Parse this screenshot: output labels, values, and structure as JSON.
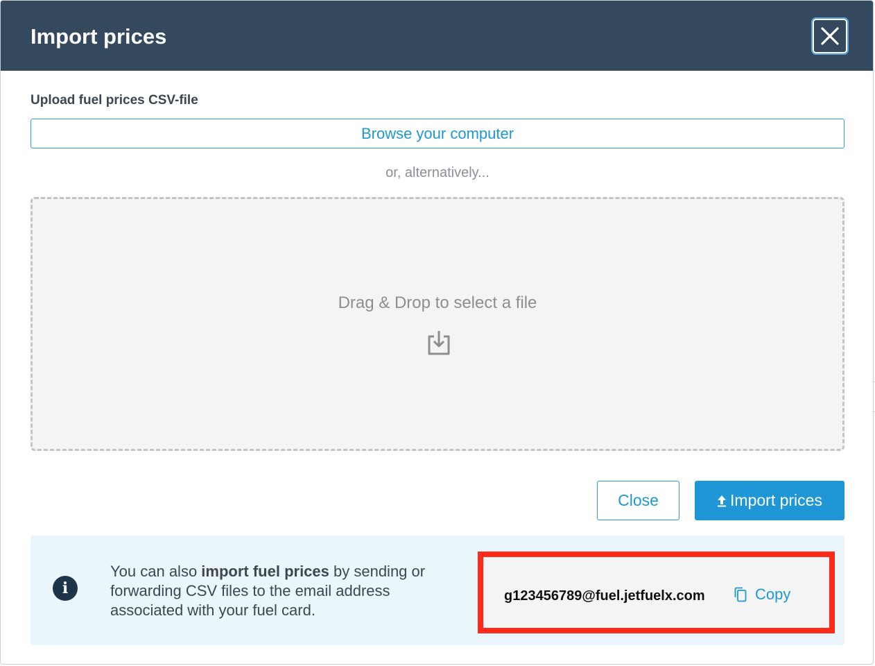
{
  "header": {
    "title": "Import prices",
    "close_icon": "close-icon"
  },
  "upload": {
    "label": "Upload fuel prices CSV-file",
    "browse_label": "Browse your computer",
    "alternative_text": "or, alternatively...",
    "dropzone_text": "Drag & Drop to select a file",
    "dropzone_icon": "download-tray-icon"
  },
  "footer": {
    "close_label": "Close",
    "import_label": "Import prices",
    "import_icon": "upload-arrow-icon"
  },
  "info": {
    "icon": "info-icon",
    "icon_glyph": "i",
    "text_before": "You can also ",
    "text_bold": "import fuel prices",
    "text_after": " by sending or forwarding CSV files to the email address associated with your fuel card.",
    "email": "g123456789@fuel.jetfuelx.com",
    "copy_label": "Copy",
    "copy_icon": "copy-icon"
  },
  "colors": {
    "header_bg": "#34495e",
    "accent": "#1f97d6",
    "info_bg": "#ebf5fc",
    "highlight_border": "#ff2a1a"
  }
}
